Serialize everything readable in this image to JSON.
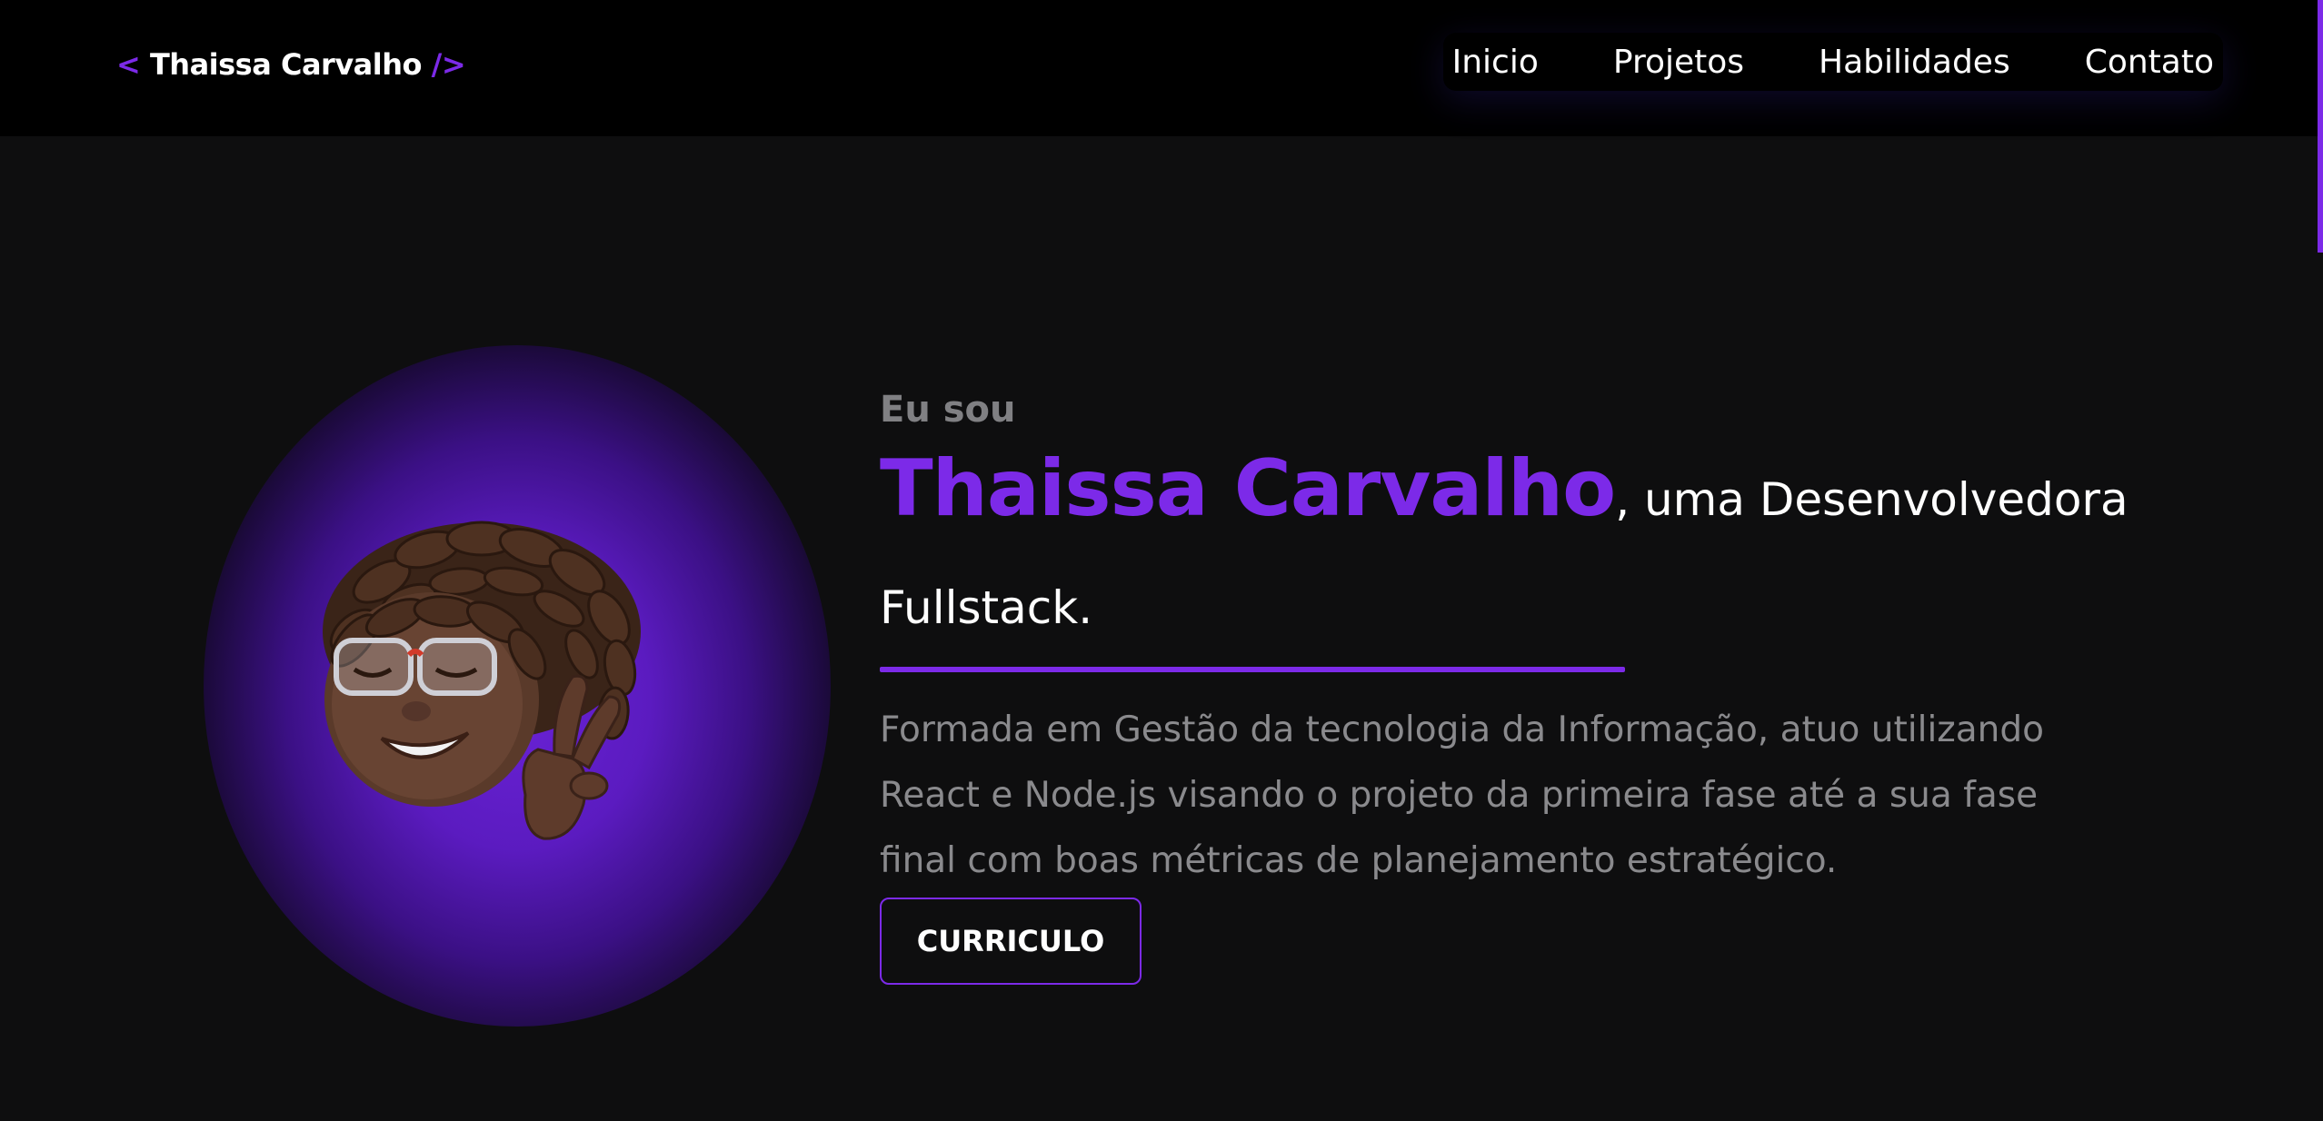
{
  "header": {
    "logo": {
      "open_bracket": "<",
      "name": "Thaissa Carvalho",
      "close_bracket": "/>"
    },
    "nav": [
      {
        "label": "Inicio"
      },
      {
        "label": "Projetos"
      },
      {
        "label": "Habilidades"
      },
      {
        "label": "Contato"
      }
    ]
  },
  "hero": {
    "intro": "Eu sou",
    "name": "Thaissa Carvalho",
    "role_line1": ", uma Desenvolvedora",
    "role_line2": "Fullstack.",
    "description_lines": [
      "Formada em Gestão da tecnologia da Informação, atuo utilizando",
      "React e Node.js visando o projeto da primeira fase até a sua fase",
      "final com boas métricas de planejamento estratégico."
    ],
    "cta_label": "CURRICULO"
  },
  "theme": {
    "accent": "#7c2ae8",
    "background": "#0e0e0f",
    "header_background": "#000000",
    "muted_text": "#8a8a8d"
  },
  "icons": {
    "avatar": "memoji-avatar-icon"
  }
}
